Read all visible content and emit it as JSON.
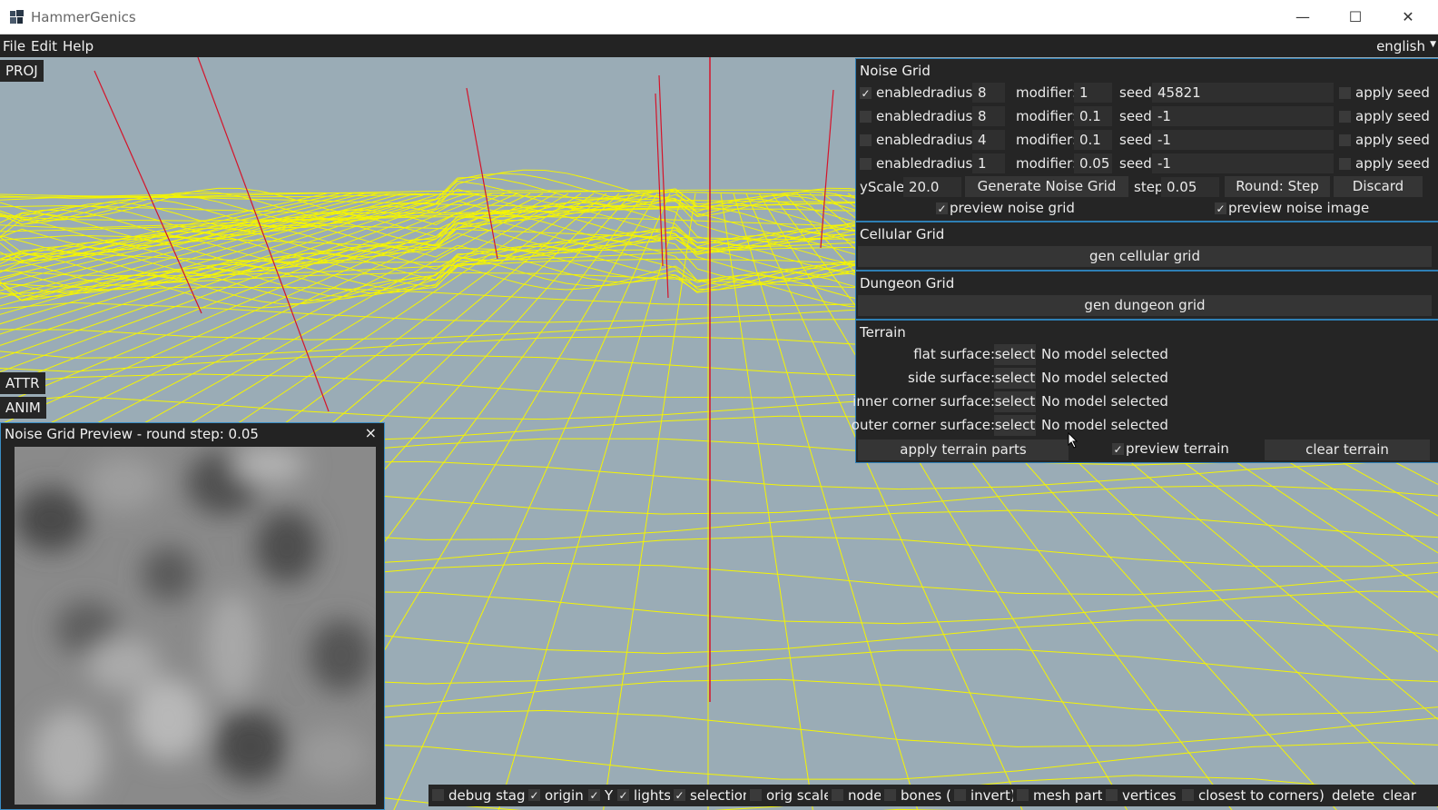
{
  "window": {
    "title": "HammerGenics",
    "minimize": "—",
    "maximize": "☐",
    "close": "✕"
  },
  "menu": {
    "file": "File",
    "edit": "Edit",
    "help": "Help",
    "language": "english"
  },
  "side_tabs": {
    "proj": "PROJ",
    "attr": "ATTR",
    "anim": "ANIM"
  },
  "noise_grid": {
    "title": "Noise Grid",
    "rows": [
      {
        "enabled": true,
        "enabled_label": "enabled",
        "radius_label": "radius:",
        "radius": "8",
        "modifier_label": "modifier:",
        "modifier": "1",
        "seed_label": "seed:",
        "seed": "45821",
        "apply_label": "apply seed"
      },
      {
        "enabled": false,
        "enabled_label": "enabled",
        "radius_label": "radius:",
        "radius": "8",
        "modifier_label": "modifier:",
        "modifier": "0.1",
        "seed_label": "seed:",
        "seed": "-1",
        "apply_label": "apply seed"
      },
      {
        "enabled": false,
        "enabled_label": "enabled",
        "radius_label": "radius:",
        "radius": "4",
        "modifier_label": "modifier:",
        "modifier": "0.1",
        "seed_label": "seed:",
        "seed": "-1",
        "apply_label": "apply seed"
      },
      {
        "enabled": false,
        "enabled_label": "enabled",
        "radius_label": "radius:",
        "radius": "1",
        "modifier_label": "modifier:",
        "modifier": "0.05",
        "seed_label": "seed:",
        "seed": "-1",
        "apply_label": "apply seed"
      }
    ],
    "yscale_label": "yScale:",
    "yscale": "20.0",
    "generate_button": "Generate Noise Grid",
    "step_label": "step:",
    "step": "0.05",
    "round_button": "Round: Step",
    "discard_button": "Discard",
    "preview_grid_label": "preview noise grid",
    "preview_image_label": "preview noise image"
  },
  "cellular_grid": {
    "title": "Cellular Grid",
    "button": "gen cellular grid"
  },
  "dungeon_grid": {
    "title": "Dungeon Grid",
    "button": "gen dungeon grid"
  },
  "terrain": {
    "title": "Terrain",
    "surfaces": [
      {
        "label": "flat surface:",
        "select": "select",
        "value": "No model selected"
      },
      {
        "label": "side surface:",
        "select": "select",
        "value": "No model selected"
      },
      {
        "label": "inner corner surface:",
        "select": "select",
        "value": "No model selected"
      },
      {
        "label": "outer corner surface:",
        "select": "select",
        "value": "No model selected"
      }
    ],
    "apply_button": "apply terrain parts",
    "preview_label": "preview terrain",
    "clear_button": "clear terrain"
  },
  "preview_window": {
    "title": "Noise Grid Preview - round step: 0.05",
    "close": "×"
  },
  "bottom_bar": {
    "debug_stage": "debug stage",
    "origin": "origin",
    "y": "Y",
    "lights": "lights",
    "selection": "selection",
    "orig_scale": "orig scale",
    "nodes": "nodes",
    "bones": "bones (",
    "invert": "invert)",
    "mesh_parts": "mesh parts",
    "vertices": "vertices (",
    "closest": "closest to corners)",
    "delete": "delete",
    "clear_all": "clear all"
  },
  "colors": {
    "viewport_bg": "#9aacb6",
    "wire": "#f5f500",
    "axis": "#d4142a",
    "panel_bg": "#252525",
    "panel_border": "#2e7fb5"
  }
}
